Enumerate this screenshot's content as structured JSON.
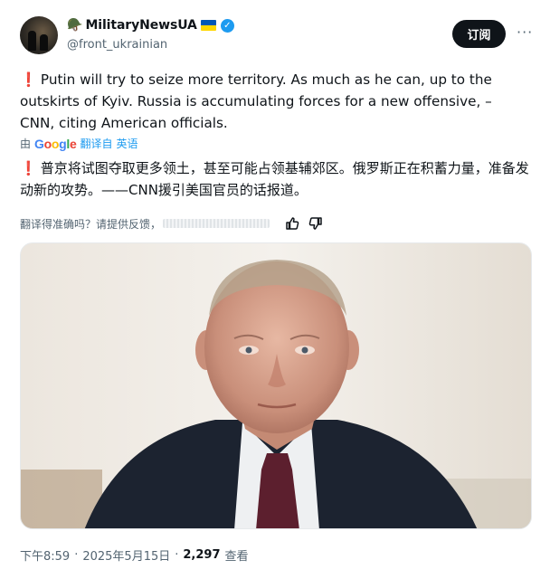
{
  "author": {
    "display_name": "MilitaryNewsUA",
    "handle": "@front_ukrainian",
    "verified": true,
    "prefix_icon": "military-helmet-icon",
    "flag": "ukraine-flag-icon"
  },
  "actions": {
    "follow_label": "订阅",
    "more_label": "···"
  },
  "tweet": {
    "text_en": "Putin will try to seize more territory. As much as he can, up to the outskirts of Kyiv. Russia is accumulating forces for a new offensive, – CNN, citing American officials.",
    "text_zh": "普京将试图夺取更多领土，甚至可能占领基辅郊区。俄罗斯正在积蓄力量，准备发动新的攻势。——CNN援引美国官员的话报道。",
    "bullet_icon": "red-exclamation-icon"
  },
  "translation": {
    "by": "由",
    "provider": "Google",
    "translated_from": "翻译自",
    "language": "英语",
    "feedback_prompt": "翻译得准确吗？请提供反馈，"
  },
  "meta": {
    "time": "下午8:59",
    "sep1": "·",
    "date": "2025年5月15日",
    "sep2": "·",
    "views": "2,297",
    "views_label": "查看"
  },
  "colors": {
    "verified_blue": "#1d9bf0",
    "follow_bg": "#0f1419",
    "text_primary": "#0f1419",
    "text_secondary": "#536471",
    "ukraine_blue": "#0057b7",
    "ukraine_yellow": "#ffd700"
  }
}
